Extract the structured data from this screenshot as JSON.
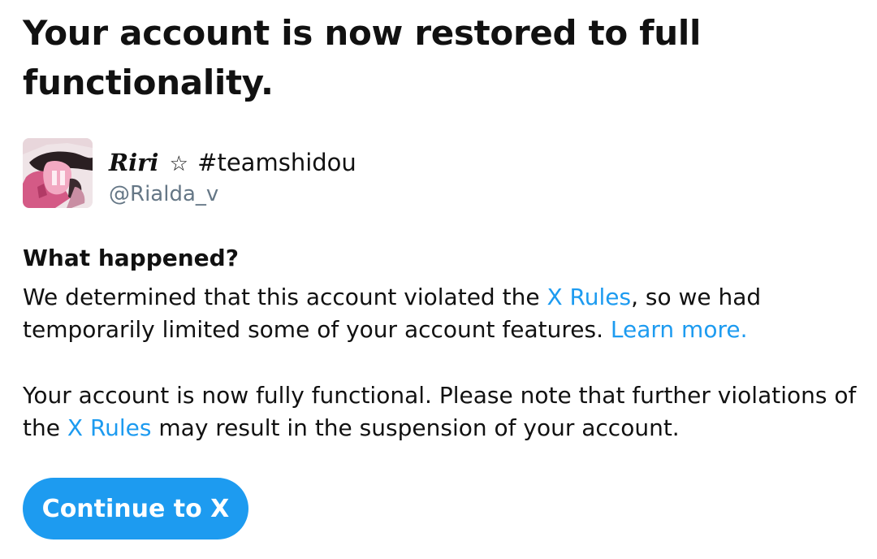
{
  "headline": "Your account is now restored to full functionality.",
  "profile": {
    "display_name": "Riri",
    "star": "☆",
    "tag": "#teamshidou",
    "handle": "@Rialda_v",
    "avatar_icon": "user-avatar-image"
  },
  "section": {
    "title": "What happened?"
  },
  "paragraph1": {
    "text_a": "We determined that this account violated the ",
    "link_rules": "X Rules",
    "text_b": ", so we had temporarily limited some of your account features. ",
    "link_learn": "Learn more."
  },
  "paragraph2": {
    "text_a": "Your account is now fully functional. Please note that further violations of the ",
    "link_rules": "X Rules",
    "text_b": " may result in the suspension of your account."
  },
  "button": {
    "label": "Continue to X"
  },
  "colors": {
    "accent": "#1d9bf0",
    "text": "#111111",
    "secondary_text": "#657786"
  }
}
